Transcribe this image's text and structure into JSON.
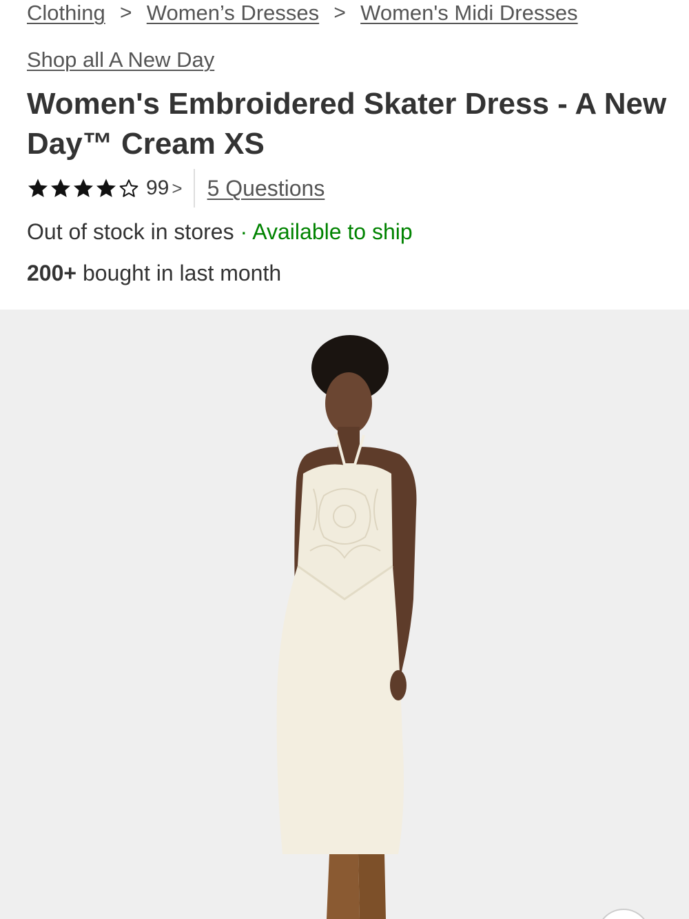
{
  "breadcrumb": {
    "items": [
      "Clothing",
      "Women’s Dresses",
      "Women's Midi Dresses"
    ],
    "separator": ">"
  },
  "brand_link": "Shop all A New Day",
  "product": {
    "title": "Women's Embroidered Skater Dress - A New Day™ Cream XS",
    "rating": 4,
    "rating_max": 5,
    "review_count": "99",
    "review_chevron": ">",
    "questions": "5 Questions"
  },
  "availability": {
    "store_status": "Out of stock in stores",
    "separator": "·",
    "ship_status": "Available to ship",
    "ship_color": "#008300"
  },
  "social_proof": {
    "count": "200+",
    "text": "bought in last month"
  },
  "icons": {
    "filled_star": "star-filled-icon",
    "empty_star": "star-outline-icon"
  },
  "colors": {
    "image_background": "#efefef",
    "dress": "#f3eee0"
  }
}
